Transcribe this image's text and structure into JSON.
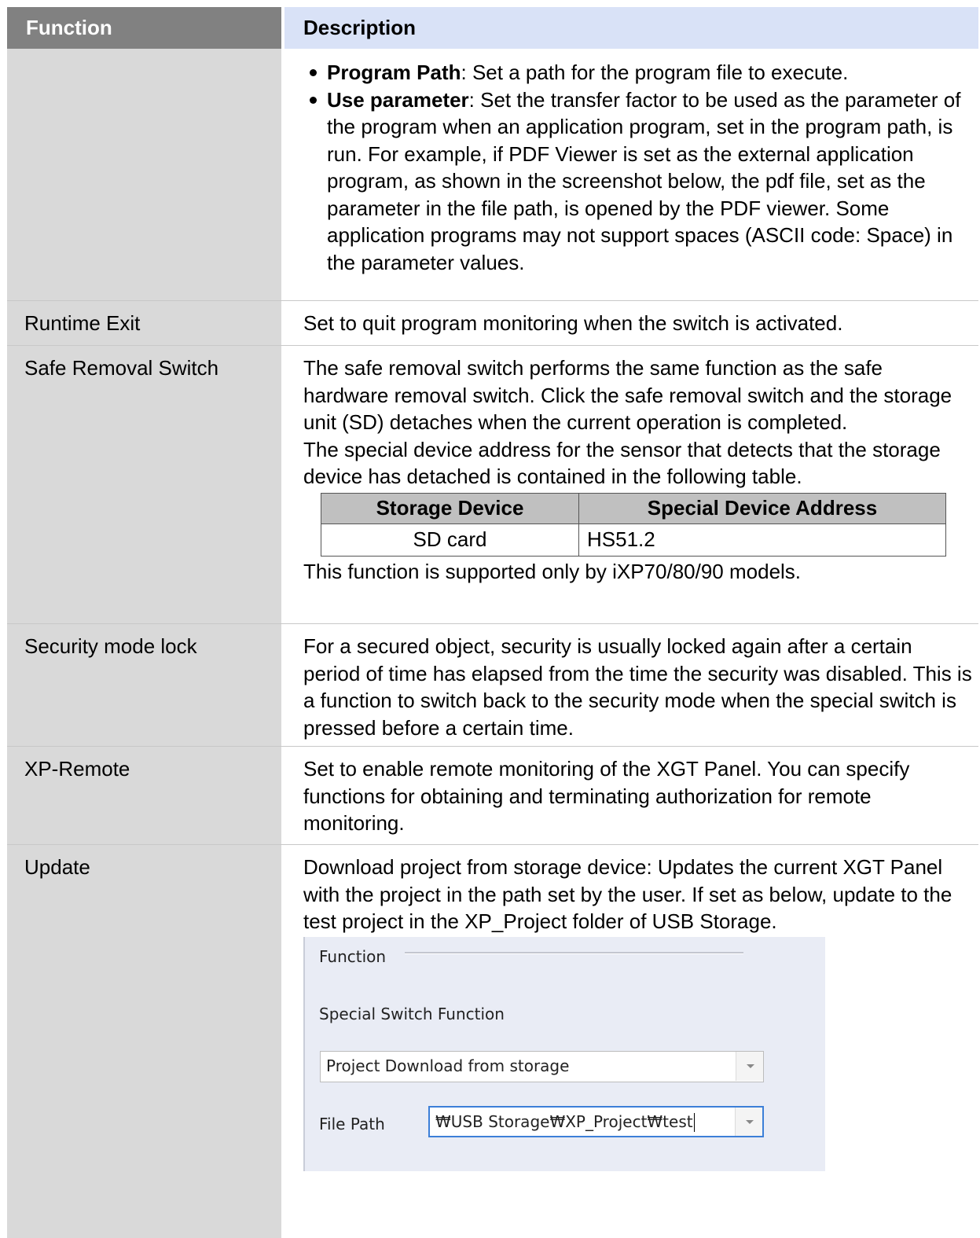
{
  "header": {
    "function": "Function",
    "description": "Description"
  },
  "row0": {
    "bullets": [
      {
        "term": "Program Path",
        "text": ": Set a path for the program file to execute."
      },
      {
        "term": "Use parameter",
        "text": ": Set the transfer factor to be used as the parameter of the program when an application program, set in the program path, is run. For example, if PDF Viewer is set as the external application program, as shown in the screenshot below, the pdf file, set as the parameter in the file path, is opened by the PDF viewer. Some application programs may not support spaces (ASCII code: Space) in the parameter values."
      }
    ]
  },
  "row1": {
    "function": "Runtime Exit",
    "description": "Set to quit program monitoring when the switch is activated."
  },
  "row2": {
    "function": "Safe Removal Switch",
    "p1": "The safe removal switch performs the same function as the safe hardware removal switch. Click the safe removal switch and the storage unit (SD) detaches when the current operation is completed.",
    "p2": "The special device address for the sensor that detects that the storage device has detached is contained in the following table.",
    "table": {
      "headers": [
        "Storage Device",
        "Special Device Address"
      ],
      "rows": [
        [
          "SD card",
          "HS51.2"
        ]
      ]
    },
    "note": "This function is supported only by iXP70/80/90 models."
  },
  "row3": {
    "function": "Security mode lock",
    "description": "For a secured object, security is usually locked again after a certain period of time has elapsed from the time the security was disabled. This is a function to switch back to the security mode when the special switch is pressed before a certain time."
  },
  "row4": {
    "function": "XP-Remote",
    "description": "Set to enable remote monitoring of the XGT Panel. You can specify functions for obtaining and terminating authorization for remote monitoring."
  },
  "row5": {
    "function": "Update",
    "description": "Download project from storage device: Updates the current XGT Panel with the project in the path set by the user. If set as below, update to the test project in the XP_Project folder of USB Storage.",
    "panel": {
      "legend": "Function",
      "special_switch_label": "Special Switch Function",
      "special_switch_value": "Project Download from storage",
      "file_path_label": "File Path",
      "file_path_value": "₩USB Storage₩XP_Project₩test"
    }
  }
}
